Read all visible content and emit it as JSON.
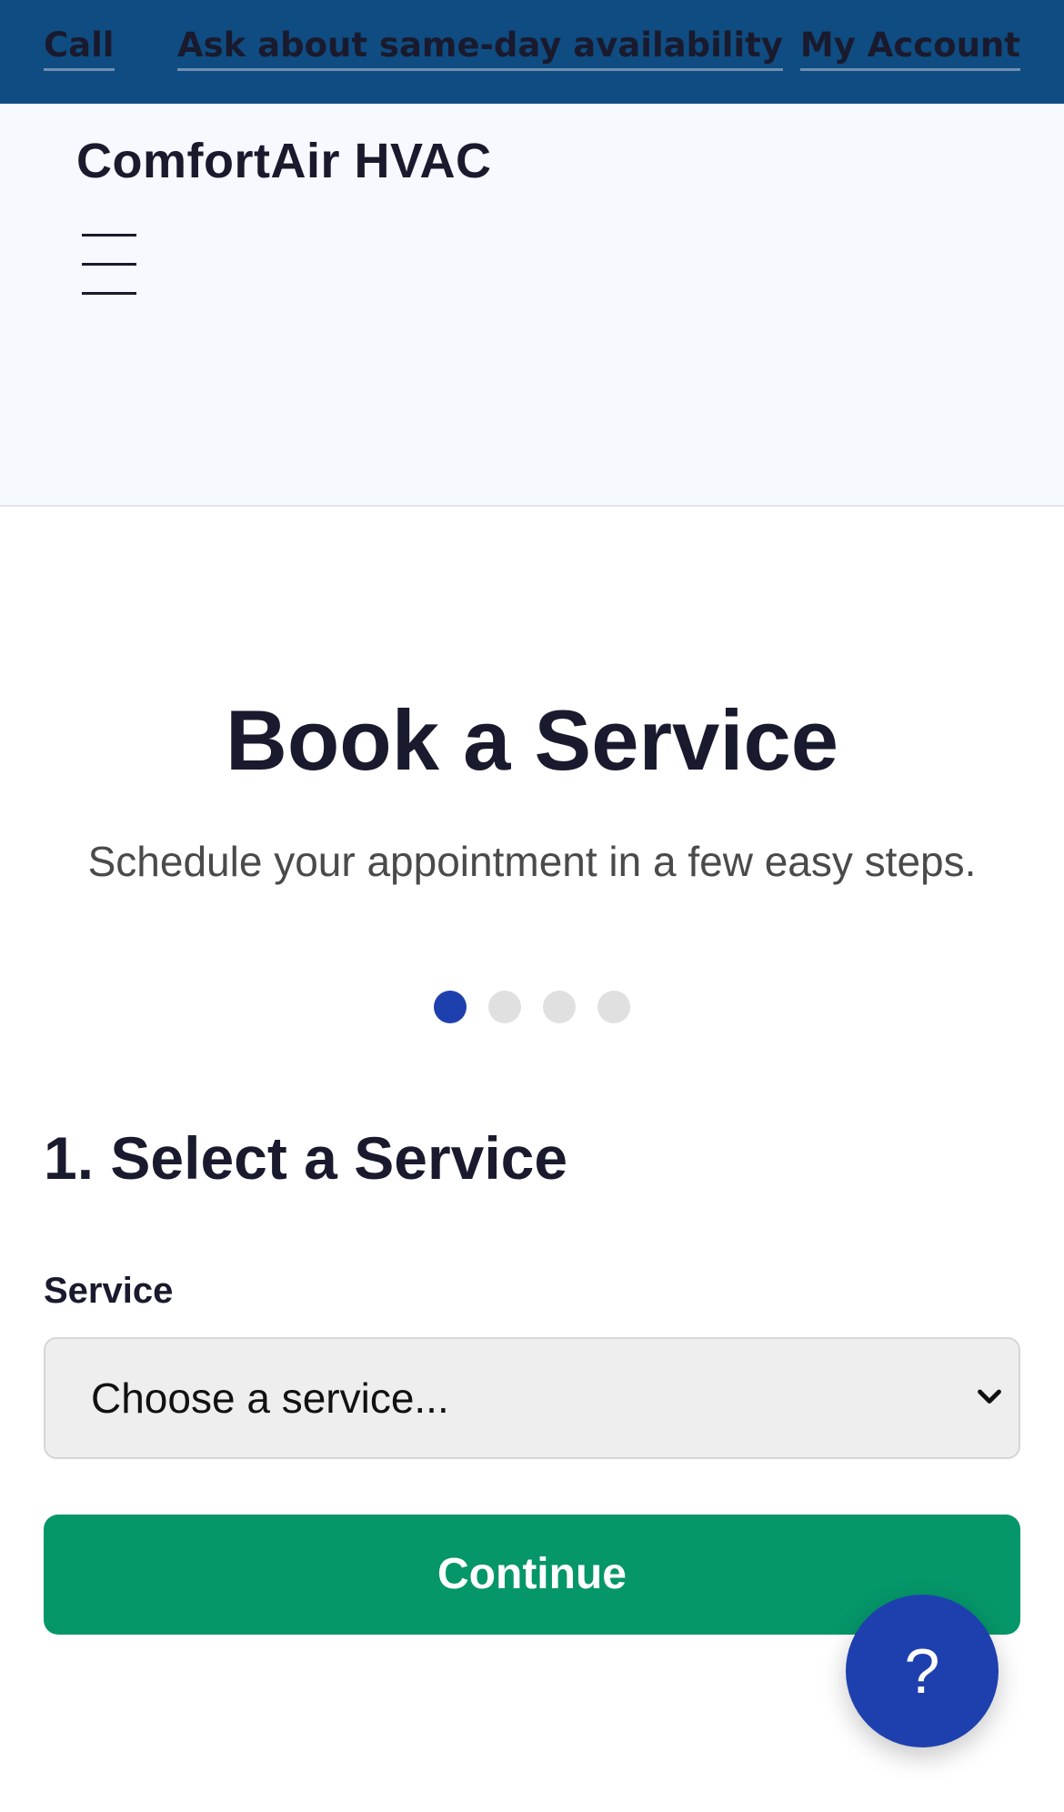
{
  "topbar": {
    "call_label": "Call",
    "sameday_label": "Ask about same-day availability",
    "account_label": "My Account"
  },
  "header": {
    "brand": "ComfortAir HVAC",
    "menu_icon": "hamburger-menu-icon"
  },
  "hero": {
    "title": "Book a Service",
    "subtitle": "Schedule your appointment in a few easy steps."
  },
  "steps": {
    "total": 4,
    "current": 1
  },
  "form": {
    "step_title": "1. Select a Service",
    "service_label": "Service",
    "service_selected": "Choose a service...",
    "continue_label": "Continue"
  },
  "help": {
    "label": "?",
    "icon": "help-icon"
  },
  "colors": {
    "topbar": "#0f4c81",
    "header_bg": "#f6f9fd",
    "accent_blue": "#1e40af",
    "continue_green": "#059669",
    "dot_inactive": "#e0e0e0"
  }
}
